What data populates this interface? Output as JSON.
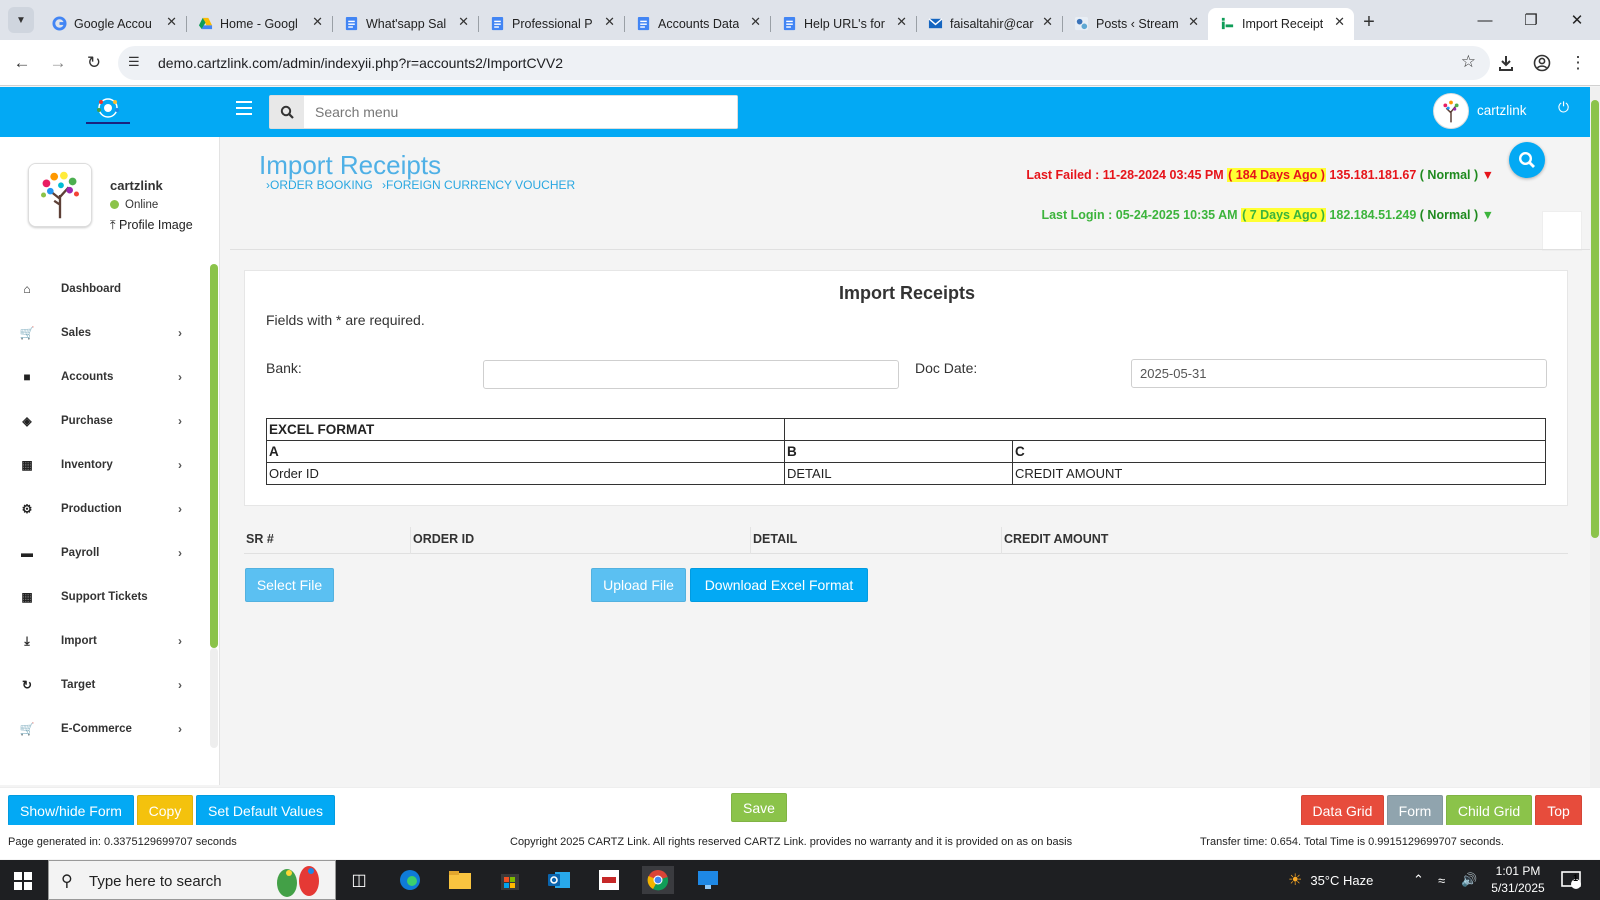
{
  "browser": {
    "tabs": [
      {
        "title": "Google Accou",
        "favicon": "google-icon"
      },
      {
        "title": "Home - Googl",
        "favicon": "drive-icon"
      },
      {
        "title": "What'sapp Sal",
        "favicon": "docs-icon"
      },
      {
        "title": "Professional P",
        "favicon": "docs-icon"
      },
      {
        "title": "Accounts Data",
        "favicon": "docs-icon"
      },
      {
        "title": "Help URL's for",
        "favicon": "docs-icon"
      },
      {
        "title": "faisaltahir@car",
        "favicon": "mail-icon"
      },
      {
        "title": "Posts ‹ Stream",
        "favicon": "wordpress-icon"
      },
      {
        "title": "Import Receipt",
        "favicon": "cartz-icon",
        "active": true
      }
    ],
    "url": "demo.cartzlink.com/admin/indexyii.php?r=accounts2/ImportCVV2"
  },
  "header": {
    "search_placeholder": "Search menu",
    "username": "cartzlink"
  },
  "sidebar": {
    "profile_name": "cartzlink",
    "status": "Online",
    "profile_image_label": "Profile Image",
    "items": [
      {
        "label": "Dashboard",
        "icon": "home-icon",
        "chevron": false
      },
      {
        "label": "Sales",
        "icon": "cart-icon",
        "chevron": true
      },
      {
        "label": "Accounts",
        "icon": "briefcase-icon",
        "chevron": true
      },
      {
        "label": "Purchase",
        "icon": "tags-icon",
        "chevron": true
      },
      {
        "label": "Inventory",
        "icon": "grid-icon",
        "chevron": true
      },
      {
        "label": "Production",
        "icon": "cogs-icon",
        "chevron": true
      },
      {
        "label": "Payroll",
        "icon": "money-icon",
        "chevron": true
      },
      {
        "label": "Support Tickets",
        "icon": "ticket-icon",
        "chevron": false
      },
      {
        "label": "Import",
        "icon": "import-icon",
        "chevron": true
      },
      {
        "label": "Target",
        "icon": "refresh-icon",
        "chevron": true
      },
      {
        "label": "E-Commerce",
        "icon": "cart-icon",
        "chevron": true
      }
    ]
  },
  "page": {
    "title": "Import Receipts",
    "breadcrumbs": [
      "›ORDER BOOKING",
      "›FOREIGN CURRENCY VOUCHER"
    ],
    "last_failed": {
      "prefix": "Last Failed : 11-28-2024 03:45 PM ",
      "ago": "( 184 Days Ago )",
      "ip": " 135.181.181.67 ",
      "level": "( Normal )",
      "arrow": " ▼"
    },
    "last_login": {
      "prefix": "Last Login : 05-24-2025 10:35 AM ",
      "ago": "( 7 Days Ago )",
      "ip": " 182.184.51.249 ",
      "level": "( Normal )",
      "arrow": " ▼"
    }
  },
  "form": {
    "title": "Import Receipts",
    "required_note": "Fields with * are required.",
    "bank_label": "Bank:",
    "bank_value": "",
    "doc_date_label": "Doc Date:",
    "doc_date_value": "2025-05-31",
    "excel_format": {
      "title": "EXCEL FORMAT",
      "columns": [
        "A",
        "B",
        "C"
      ],
      "fields": [
        "Order ID",
        "DETAIL",
        "CREDIT AMOUNT"
      ]
    }
  },
  "grid": {
    "columns": [
      "SR #",
      "ORDER ID",
      "DETAIL",
      "CREDIT AMOUNT"
    ]
  },
  "actions": {
    "select_file": "Select File",
    "upload_file": "Upload File",
    "download_format": "Download Excel Format"
  },
  "bottom_bar": {
    "show_hide": "Show/hide Form",
    "copy": "Copy",
    "set_default": "Set Default Values",
    "save": "Save",
    "data_grid": "Data Grid",
    "form": "Form",
    "child_grid": "Child Grid",
    "top": "Top"
  },
  "footer": {
    "generated": "Page generated in: 0.3375129699707 seconds",
    "copyright": "Copyright 2025 CARTZ Link. All rights reserved CARTZ Link. provides no warranty and it is provided on as on basis",
    "transfer": "Transfer time: 0.654. Total Time is 0.9915129699707 seconds."
  },
  "taskbar": {
    "search_placeholder": "Type here to search",
    "weather": "35°C  Haze",
    "time": "1:01 PM",
    "date": "5/31/2025",
    "notifications": "1"
  },
  "colors": {
    "primary": "#03a9f4",
    "green": "#8bc34a",
    "yellow": "#f4c20d",
    "red": "#e74c3c",
    "gray": "#90a4ae"
  }
}
